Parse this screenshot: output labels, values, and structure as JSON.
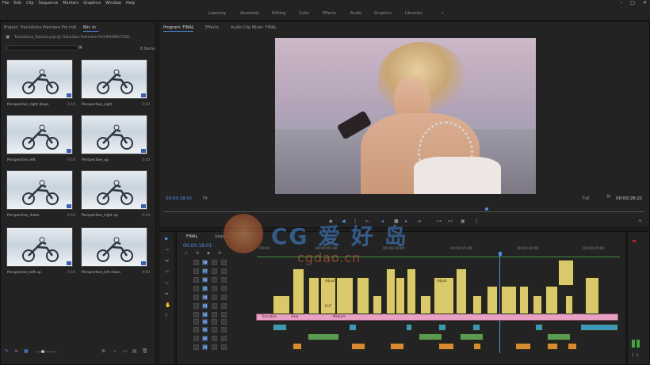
{
  "menu": [
    "File",
    "Edit",
    "Clip",
    "Sequence",
    "Markers",
    "Graphics",
    "Window",
    "Help"
  ],
  "workspaces": [
    "Learning",
    "Assembly",
    "Editing",
    "Color",
    "Effects",
    "Audio",
    "Graphics",
    "Libraries"
  ],
  "workspace_overflow": "»",
  "project": {
    "tabs": [
      "Project: Transitions Premiere Pro Initi",
      "Bin: in"
    ],
    "path": "Transitions_Tutorial.prproj\\ Transition Premiere Pro\\PERSPECTIVE\\",
    "item_count": "8 Items",
    "items": [
      {
        "label": "Perspective_right down",
        "dur": "0:10"
      },
      {
        "label": "Perspective_right",
        "dur": "0:10"
      },
      {
        "label": "Perspective_left",
        "dur": "0:10"
      },
      {
        "label": "Perspective_up",
        "dur": "0:10"
      },
      {
        "label": "Perspective_down",
        "dur": "0:10"
      },
      {
        "label": "Perspective_right up",
        "dur": "0:10"
      },
      {
        "label": "Perspective_left up",
        "dur": "0:10"
      },
      {
        "label": "Perspective_left down",
        "dur": "0:10"
      }
    ]
  },
  "program": {
    "tabs": [
      "Program: FINAL",
      "Effects",
      "Audio Clip Mixer: FINAL"
    ],
    "timecode_in": "00:00:18:01",
    "fit": "Fit",
    "quality": "Full",
    "timecode_out": "00:00:26:21"
  },
  "timeline": {
    "tab": "FINAL",
    "tab2": "Sequ...",
    "timecode": "00:00:18:01",
    "ruler": [
      "00:00",
      "00:00:05:00",
      "00:00:10:00",
      "00:00:15:00",
      "00:00:20:00",
      "00:00:25:00"
    ],
    "v_tracks": [
      "V8",
      "V7",
      "V6",
      "V5",
      "V4",
      "V3",
      "V2",
      "V1"
    ],
    "a_tracks": [
      "A1",
      "A2",
      "A3"
    ],
    "clip_labels": [
      "Transition",
      "Slow",
      "Medium",
      "Adjust",
      "Adjust",
      "FLIT"
    ]
  },
  "watermark": {
    "brand": "CG 爱 好 岛",
    "url": "cgdao.cn"
  },
  "colors": {
    "accent": "#4e8fe6",
    "yellow_clip": "#d9c96b",
    "pink_clip": "#e9a0c5",
    "cyan_clip": "#3d97b8"
  },
  "meter_labels": [
    "S",
    "S"
  ]
}
